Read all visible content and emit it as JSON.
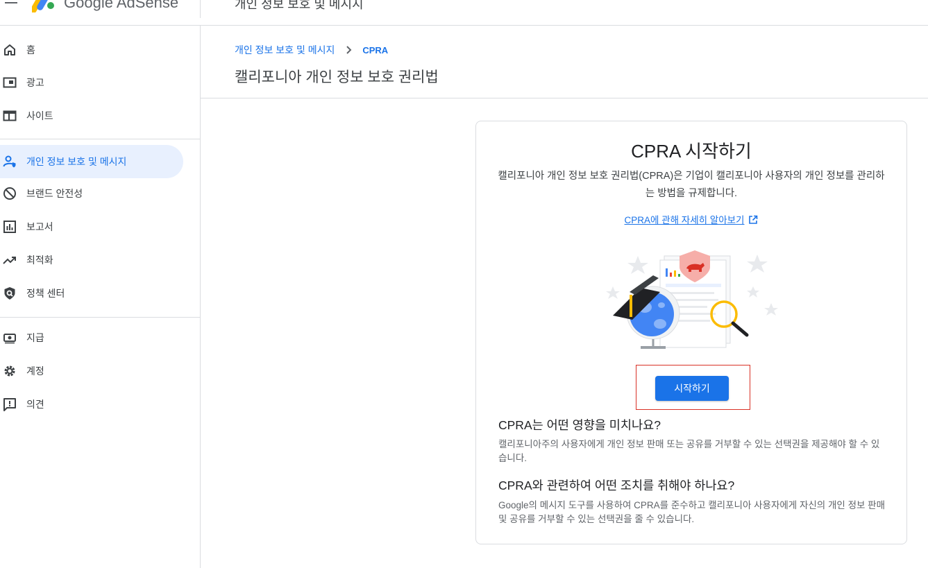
{
  "header": {
    "brand": "Google AdSense",
    "page_title": "개인 정보 보호 및 메시지"
  },
  "sidebar": {
    "items": [
      {
        "label": "홈",
        "icon": "home-icon"
      },
      {
        "label": "광고",
        "icon": "ads-icon"
      },
      {
        "label": "사이트",
        "icon": "sites-icon"
      },
      {
        "label": "개인 정보 보호 및 메시지",
        "icon": "privacy-messaging-icon",
        "active": true
      },
      {
        "label": "브랜드 안전성",
        "icon": "block-icon"
      },
      {
        "label": "보고서",
        "icon": "reports-icon"
      },
      {
        "label": "최적화",
        "icon": "trending-up-icon"
      },
      {
        "label": "정책 센터",
        "icon": "policy-shield-icon"
      },
      {
        "label": "지급",
        "icon": "payments-icon"
      },
      {
        "label": "계정",
        "icon": "gear-icon"
      },
      {
        "label": "의견",
        "icon": "feedback-icon"
      }
    ]
  },
  "breadcrumb": {
    "parent": "개인 정보 보호 및 메시지",
    "current": "CPRA"
  },
  "main": {
    "title": "캘리포니아 개인 정보 보호 권리법"
  },
  "card": {
    "title": "CPRA 시작하기",
    "description": "캘리포니아 개인 정보 보호 권리법(CPRA)은 기업이 캘리포니아 사용자의 개인 정보를 관리하는 방법을 규제합니다.",
    "learn_more": "CPRA에 관해 자세히 알아보기",
    "start_button": "시작하기",
    "q1_title": "CPRA는 어떤 영향을 미치나요?",
    "q1_body": "캘리포니아주의 사용자에게 개인 정보 판매 또는 공유를 거부할 수 있는 선택권을 제공해야 할 수 있습니다.",
    "q2_title": "CPRA와 관련하여 어떤 조치를 취해야 하나요?",
    "q2_body": "Google의 메시지 도구를 사용하여 CPRA를 준수하고 캘리포니아 사용자에게 자신의 개인 정보 판매 및 공유를 거부할 수 있는 선택권을 줄 수 있습니다."
  },
  "colors": {
    "accent": "#1a73e8",
    "active_bg": "#e8f0fe",
    "highlight": "#d93025"
  }
}
